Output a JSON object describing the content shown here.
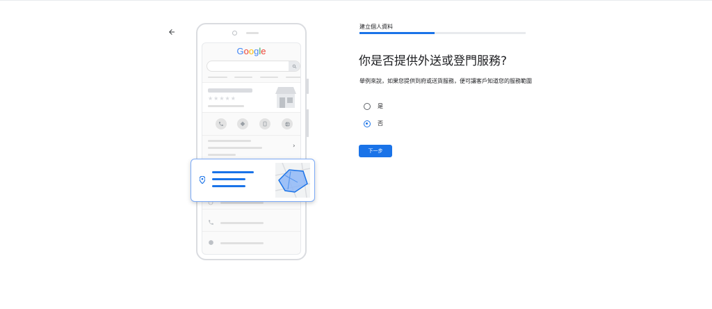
{
  "logo_text": "Google",
  "logo_letters": [
    {
      "ch": "G",
      "color": "#4285F4"
    },
    {
      "ch": "o",
      "color": "#EA4335"
    },
    {
      "ch": "o",
      "color": "#FBBC05"
    },
    {
      "ch": "g",
      "color": "#4285F4"
    },
    {
      "ch": "l",
      "color": "#34A853"
    },
    {
      "ch": "e",
      "color": "#EA4335"
    }
  ],
  "icons": {
    "back": "arrow-back-icon",
    "phone": "phone-icon",
    "directions": "directions-icon",
    "save": "save-icon",
    "website": "globe-icon",
    "location": "location-pin-icon",
    "store": "storefront-icon"
  },
  "form": {
    "step_label": "建立個人資料",
    "progress": 0.45,
    "question": "你是否提供外送或登門服務?",
    "description": "舉例來說，如果您提供到府或送貨服務，便可讓客戶知道您的服務範圍",
    "options": [
      {
        "label": "是",
        "selected": false
      },
      {
        "label": "否",
        "selected": true
      }
    ],
    "next_label": "下一步"
  },
  "colors": {
    "accent": "#1a73e8",
    "card_border": "#7baaf7"
  }
}
